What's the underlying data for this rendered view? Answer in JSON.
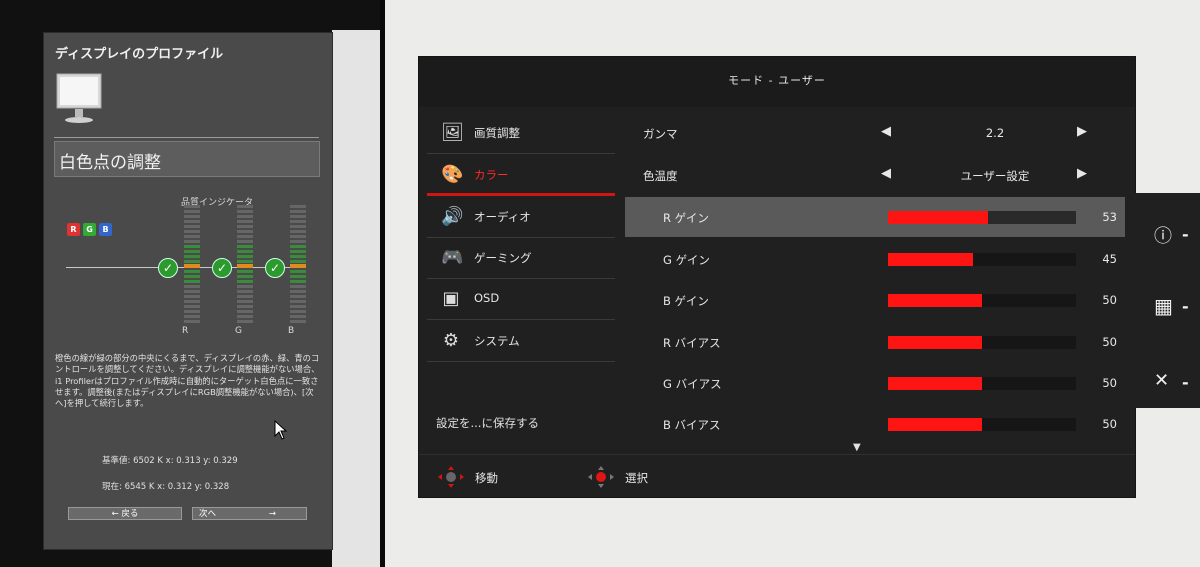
{
  "calibration_dialog": {
    "title": "ディスプレイのプロファイル",
    "section_title": "白色点の調整",
    "quality_indicator_label": "品質インジケータ",
    "rgb_chips": [
      "R",
      "G",
      "B"
    ],
    "meters": [
      {
        "channel": "R",
        "status": "ok"
      },
      {
        "channel": "G",
        "status": "ok"
      },
      {
        "channel": "B",
        "status": "ok"
      }
    ],
    "instructions": "橙色の線が緑の部分の中央にくるまで、ディスプレイの赤、緑、青のコントロールを調整してください。ディスプレイに調整機能がない場合、i1 Profilerはプロファイル作成時に自動的にターゲット白色点に一致させます。調整後(またはディスプレイにRGB調整機能がない場合)、[次へ]を押して続行します。",
    "reference_line": "基準値:  6502 K    x: 0.313  y: 0.329",
    "current_line": "現在:  6545 K    x: 0.312  y: 0.328",
    "back_button": "← 戻る",
    "next_button": "次へ",
    "next_arrow": "→"
  },
  "osd": {
    "header_title": "モード - ユーザー",
    "menu": [
      {
        "icon": "picture-icon",
        "glyph": "🖼",
        "label": "画質調整",
        "active": false
      },
      {
        "icon": "palette-icon",
        "glyph": "🎨",
        "label": "カラー",
        "active": true
      },
      {
        "icon": "speaker-icon",
        "glyph": "🔊",
        "label": "オーディオ",
        "active": false
      },
      {
        "icon": "gamepad-icon",
        "glyph": "🎮",
        "label": "ゲーミング",
        "active": false
      },
      {
        "icon": "osd-icon",
        "glyph": "▣",
        "label": "OSD",
        "active": false
      },
      {
        "icon": "gear-icon",
        "glyph": "⚙",
        "label": "システム",
        "active": false
      }
    ],
    "save_label": "設定を...に保存する",
    "settings": [
      {
        "label": "ガンマ",
        "value": "2.2"
      },
      {
        "label": "色温度",
        "value": "ユーザー設定"
      }
    ],
    "sliders": [
      {
        "label": "R ゲイン",
        "value": "53",
        "fraction": 0.53,
        "selected": true
      },
      {
        "label": "G ゲイン",
        "value": "45",
        "fraction": 0.45,
        "selected": false
      },
      {
        "label": "B ゲイン",
        "value": "50",
        "fraction": 0.5,
        "selected": false
      },
      {
        "label": "R バイアス",
        "value": "50",
        "fraction": 0.5,
        "selected": false
      },
      {
        "label": "G バイアス",
        "value": "50",
        "fraction": 0.5,
        "selected": false
      },
      {
        "label": "B バイアス",
        "value": "50",
        "fraction": 0.5,
        "selected": false
      }
    ],
    "footer": [
      {
        "icon": "dpad-move-icon",
        "label": "移動"
      },
      {
        "icon": "dpad-select-icon",
        "label": "選択"
      }
    ],
    "side_keys": [
      {
        "icon": "info-icon",
        "glyph": "ⓘ"
      },
      {
        "icon": "grid-icon",
        "glyph": "▦"
      },
      {
        "icon": "close-icon",
        "glyph": "✕"
      }
    ],
    "accent_color": "#ff1414"
  }
}
